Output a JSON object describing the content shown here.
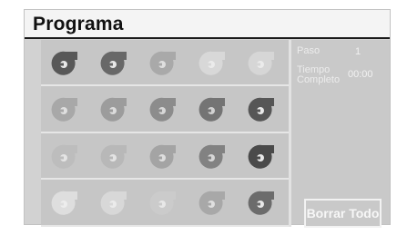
{
  "window": {
    "title": "Programa"
  },
  "fan_grid": {
    "rows": [
      [
        {
          "color": "#585858",
          "active": true
        },
        {
          "color": "#686868",
          "active": true
        },
        {
          "color": "#a9a9a9",
          "active": false
        },
        {
          "color": "#d8d8d8",
          "active": false
        },
        {
          "color": "#d6d6d6",
          "active": false
        }
      ],
      [
        {
          "color": "#a8a8a8",
          "active": false
        },
        {
          "color": "#9c9c9c",
          "active": false
        },
        {
          "color": "#8c8c8c",
          "active": false
        },
        {
          "color": "#747474",
          "active": false
        },
        {
          "color": "#565656",
          "active": true
        }
      ],
      [
        {
          "color": "#bdbdbd",
          "active": false
        },
        {
          "color": "#b8b8b8",
          "active": false
        },
        {
          "color": "#a4a4a4",
          "active": false
        },
        {
          "color": "#828282",
          "active": false
        },
        {
          "color": "#4a4a4a",
          "active": true
        }
      ],
      [
        {
          "color": "#dedede",
          "active": false
        },
        {
          "color": "#d8d8d8",
          "active": false
        },
        {
          "color": "#cbcbcb",
          "active": false
        },
        {
          "color": "#a8a8a8",
          "active": false
        },
        {
          "color": "#6c6c6c",
          "active": true
        }
      ]
    ]
  },
  "info": {
    "paso_label": "Paso",
    "paso_value": "1",
    "tiempo_label_1": "Tiempo",
    "tiempo_label_2": "Completo",
    "tiempo_value": "00:00"
  },
  "buttons": {
    "clear_all": "Borrar Todo"
  }
}
